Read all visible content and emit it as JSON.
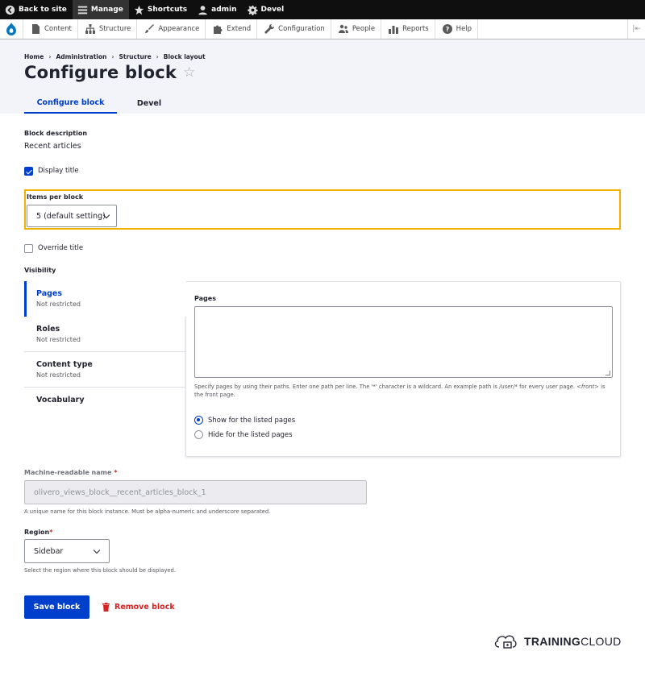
{
  "toolbar": {
    "back": "Back to site",
    "manage": "Manage",
    "shortcuts": "Shortcuts",
    "user": "admin",
    "devel": "Devel"
  },
  "tray": {
    "items": [
      "Content",
      "Structure",
      "Appearance",
      "Extend",
      "Configuration",
      "People",
      "Reports",
      "Help"
    ]
  },
  "breadcrumb": [
    "Home",
    "Administration",
    "Structure",
    "Block layout"
  ],
  "breadcrumb_sep": "›",
  "page_title": "Configure block",
  "tabs": [
    "Configure block",
    "Devel"
  ],
  "block_description": {
    "label": "Block description",
    "value": "Recent articles"
  },
  "display_title": {
    "label": "Display title",
    "checked": true
  },
  "items_per_block": {
    "label": "Items per block",
    "value": "5 (default setting)"
  },
  "override_title": {
    "label": "Override title",
    "checked": false
  },
  "visibility": {
    "label": "Visibility",
    "tabs": [
      {
        "title": "Pages",
        "summary": "Not restricted"
      },
      {
        "title": "Roles",
        "summary": "Not restricted"
      },
      {
        "title": "Content type",
        "summary": "Not restricted"
      },
      {
        "title": "Vocabulary",
        "summary": ""
      }
    ],
    "pages": {
      "label": "Pages",
      "value": "",
      "help_1": "Specify pages by using their paths. Enter one path per line. The '*' character is a wildcard. An example path is ",
      "help_path": "/user/*",
      "help_2": " for every user page. ",
      "help_front": "<front>",
      "help_3": " is the front page.",
      "radios": [
        "Show for the listed pages",
        "Hide for the listed pages"
      ],
      "selected": 0
    }
  },
  "machine_name": {
    "label": "Machine-readable name",
    "required_mark": "*",
    "value": "olivero_views_block__recent_articles_block_1",
    "help": "A unique name for this block instance. Must be alpha-numeric and underscore separated."
  },
  "region": {
    "label": "Region",
    "required_mark": "*",
    "value": "Sidebar",
    "help": "Select the region where this block should be displayed."
  },
  "actions": {
    "save": "Save block",
    "remove": "Remove block"
  },
  "brand": {
    "bold": "TRAINING",
    "rest": "CLOUD"
  },
  "colors": {
    "accent": "#003ecc",
    "danger": "#d72222",
    "highlight": "#f0b400",
    "toolbar": "#0f0f0f"
  }
}
